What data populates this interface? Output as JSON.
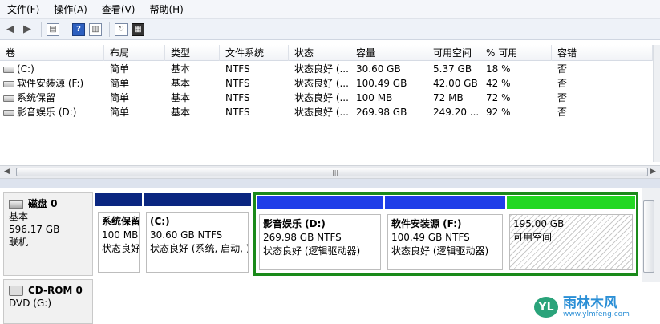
{
  "menu": [
    "文件(F)",
    "操作(A)",
    "查看(V)",
    "帮助(H)"
  ],
  "toolbar_icons": [
    "back-icon",
    "forward-icon",
    "console-tree-icon",
    "help-icon",
    "show-pane-icon",
    "refresh-icon",
    "properties-icon"
  ],
  "list": {
    "columns": [
      "卷",
      "布局",
      "类型",
      "文件系统",
      "状态",
      "容量",
      "可用空间",
      "% 可用",
      "容错"
    ],
    "rows": [
      [
        "(C:)",
        "简单",
        "基本",
        "NTFS",
        "状态良好 (...",
        "30.60 GB",
        "5.37 GB",
        "18 %",
        "否"
      ],
      [
        "软件安装源 (F:)",
        "简单",
        "基本",
        "NTFS",
        "状态良好 (...",
        "100.49 GB",
        "42.00 GB",
        "42 %",
        "否"
      ],
      [
        "系统保留",
        "简单",
        "基本",
        "NTFS",
        "状态良好 (...",
        "100 MB",
        "72 MB",
        "72 %",
        "否"
      ],
      [
        "影音娱乐 (D:)",
        "简单",
        "基本",
        "NTFS",
        "状态良好 (...",
        "269.98 GB",
        "249.20 ...",
        "92 %",
        "否"
      ]
    ]
  },
  "disk0": {
    "name": "磁盘 0",
    "type": "基本",
    "size": "596.17 GB",
    "status": "联机"
  },
  "partitions": [
    {
      "title": "系统保留",
      "line2": "100 MB",
      "line3": "状态良好",
      "bar_color": "#0a2680"
    },
    {
      "title": "(C:)",
      "line2": "30.60 GB NTFS",
      "line3": "状态良好 (系统, 启动, )",
      "bar_color": "#0a2680"
    },
    {
      "title": "影音娱乐  (D:)",
      "line2": "269.98 GB NTFS",
      "line3": "状态良好 (逻辑驱动器)",
      "bar_color": "#1f3ee8"
    },
    {
      "title": "软件安装源  (F:)",
      "line2": "100.49 GB NTFS",
      "line3": "状态良好 (逻辑驱动器)",
      "bar_color": "#1f3ee8"
    },
    {
      "title": "",
      "line2": "195.00 GB",
      "line3": "可用空间",
      "bar_color": "#22d822"
    }
  ],
  "cdrom": {
    "name": "CD-ROM 0",
    "drive": "DVD (G:)"
  },
  "watermark": {
    "logo": "YL",
    "text": "雨林木风",
    "url": "www.ylmfeng.com"
  }
}
